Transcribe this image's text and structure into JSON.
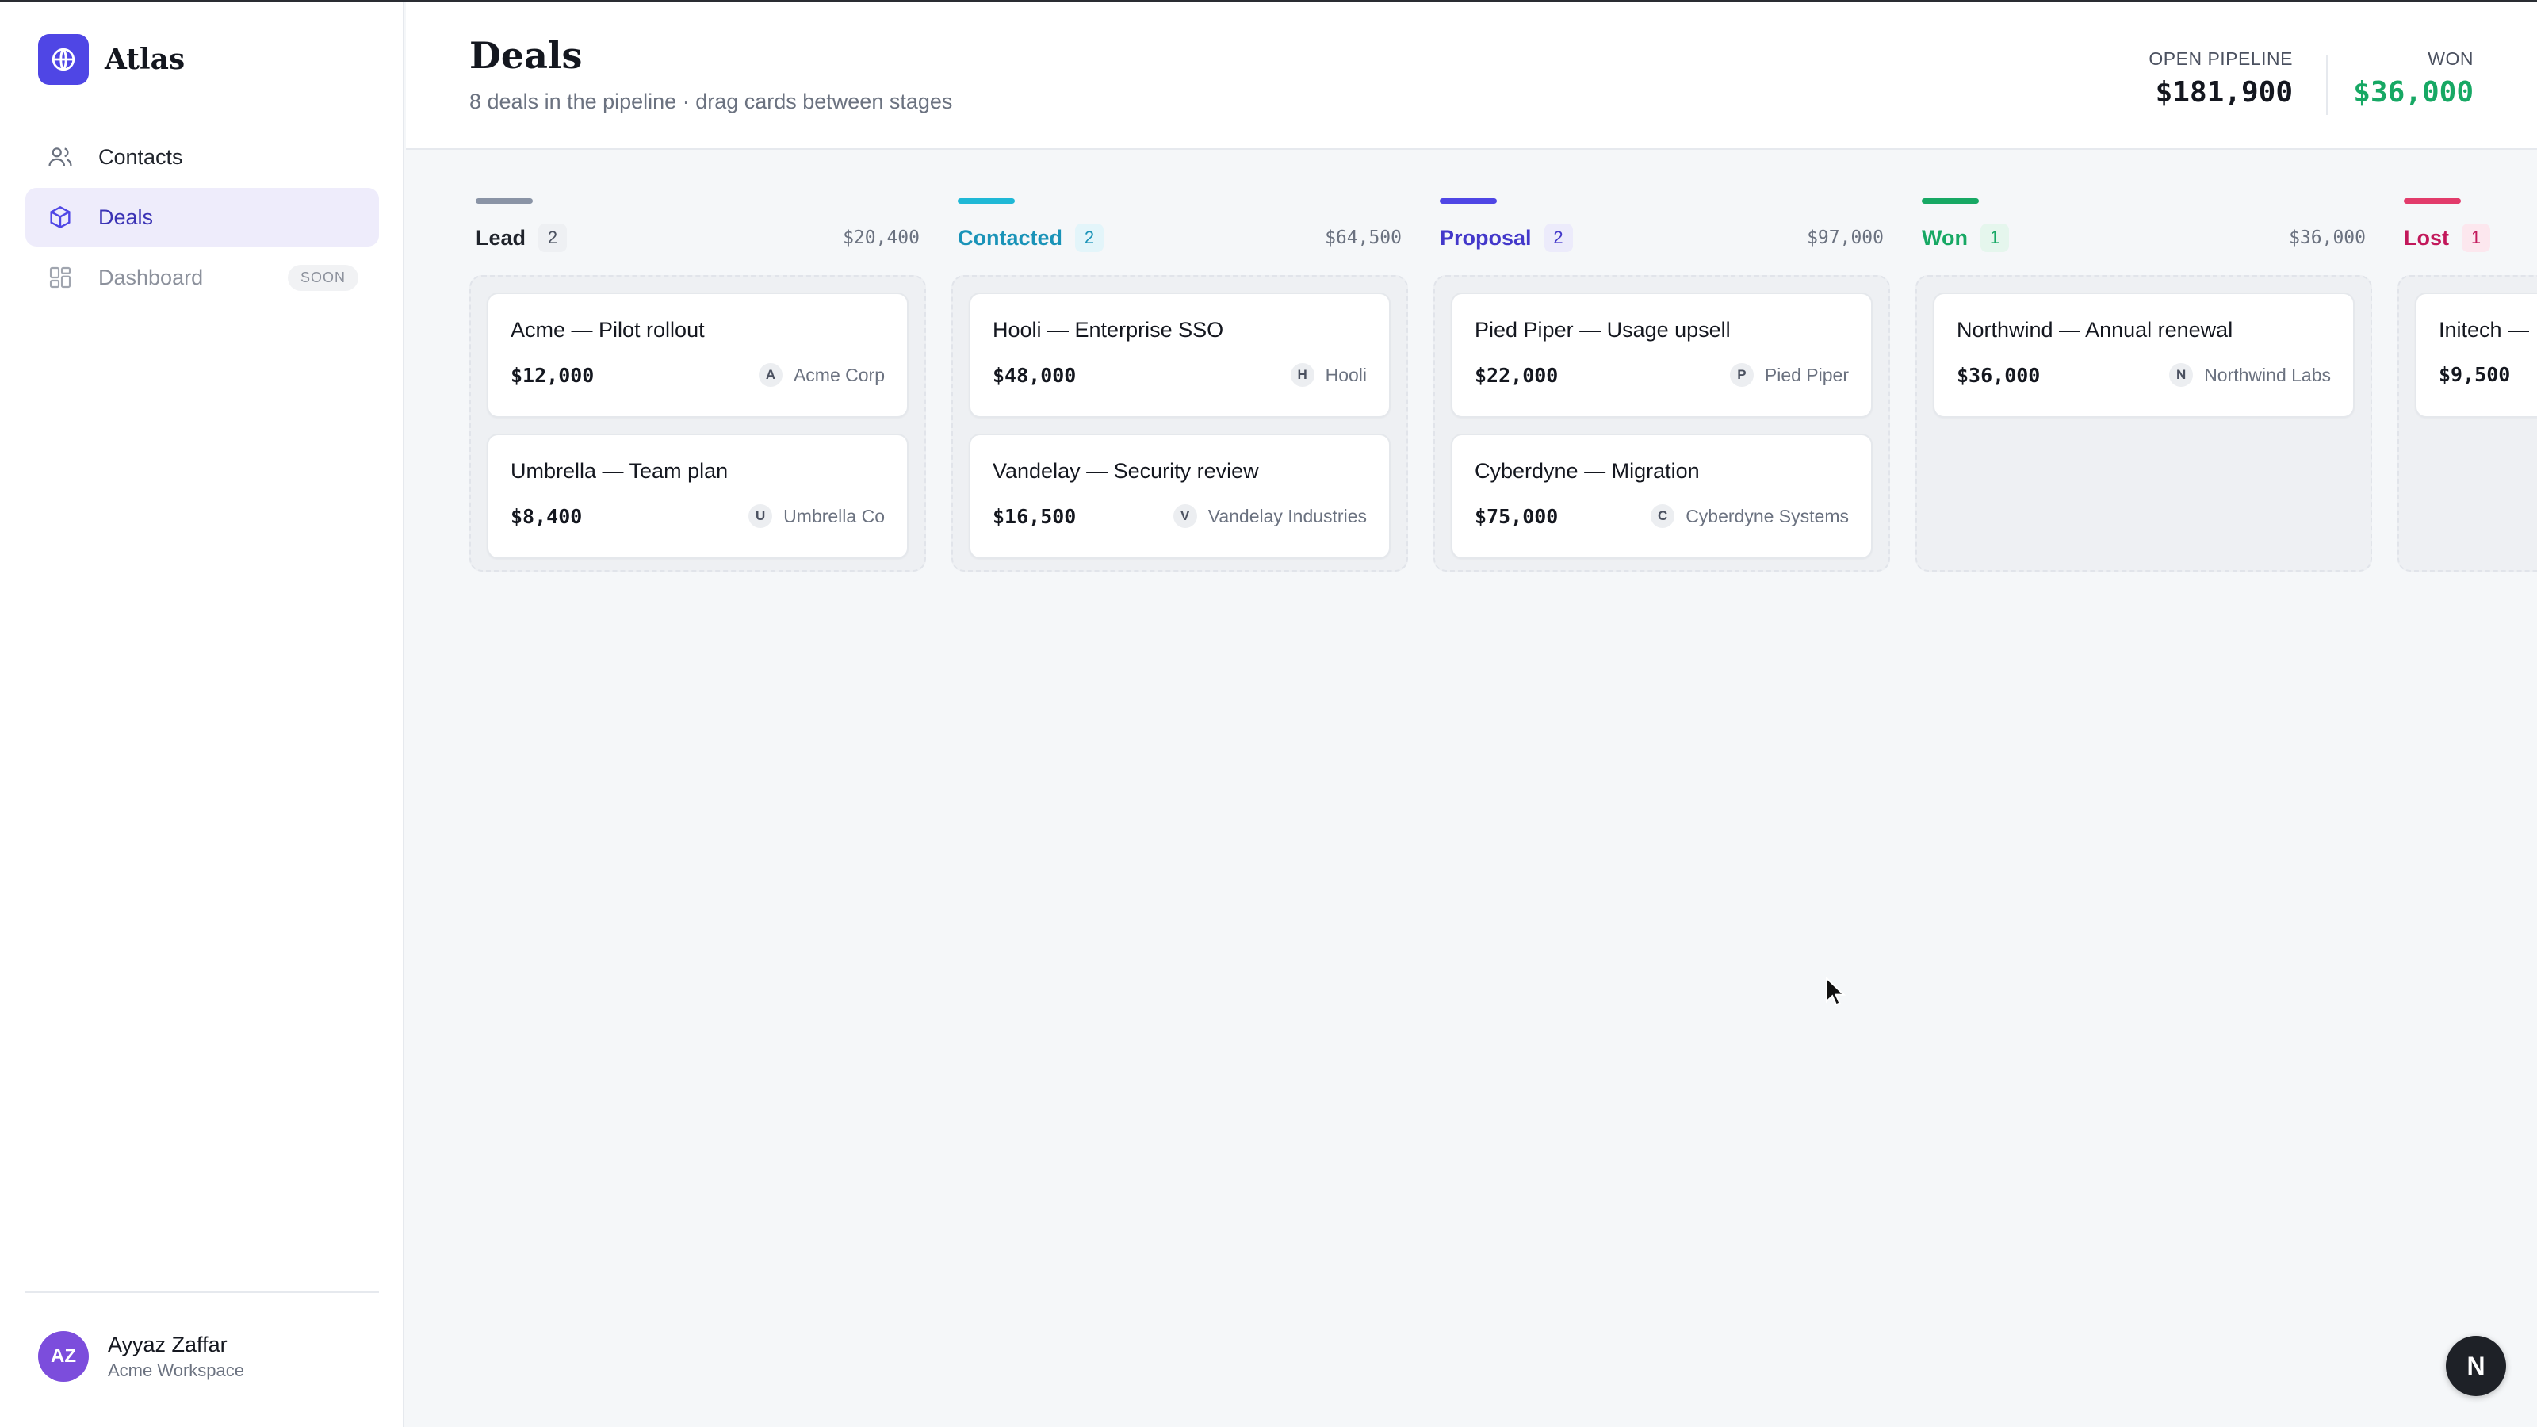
{
  "app": {
    "name": "Atlas"
  },
  "nav": [
    {
      "label": "Contacts",
      "icon": "users-icon",
      "state": "default"
    },
    {
      "label": "Deals",
      "icon": "box-icon",
      "state": "active"
    },
    {
      "label": "Dashboard",
      "icon": "grid-icon",
      "state": "muted",
      "badge": "SOON"
    }
  ],
  "user": {
    "initials": "AZ",
    "name": "Ayyaz Zaffar",
    "workspace": "Acme Workspace"
  },
  "header": {
    "title": "Deals",
    "subtitle": "8 deals in the pipeline · drag cards between stages",
    "stats": {
      "open_pipeline_label": "OPEN PIPELINE",
      "open_pipeline_value": "$181,900",
      "won_label": "WON",
      "won_value": "$36,000"
    }
  },
  "colors": {
    "accent": "#4f46e5",
    "lead": "#8a94a6",
    "contacted": "#1fb8d6",
    "proposal": "#4f46e5",
    "won": "#17a864",
    "lost": "#e23b6b"
  },
  "columns": [
    {
      "name": "Lead",
      "count": "2",
      "total": "$20,400",
      "cards": [
        {
          "title": "Acme — Pilot rollout",
          "amount": "$12,000",
          "initial": "A",
          "company": "Acme Corp"
        },
        {
          "title": "Umbrella — Team plan",
          "amount": "$8,400",
          "initial": "U",
          "company": "Umbrella Co"
        }
      ]
    },
    {
      "name": "Contacted",
      "count": "2",
      "total": "$64,500",
      "cards": [
        {
          "title": "Hooli — Enterprise SSO",
          "amount": "$48,000",
          "initial": "H",
          "company": "Hooli"
        },
        {
          "title": "Vandelay — Security review",
          "amount": "$16,500",
          "initial": "V",
          "company": "Vandelay Industries"
        }
      ]
    },
    {
      "name": "Proposal",
      "count": "2",
      "total": "$97,000",
      "cards": [
        {
          "title": "Pied Piper — Usage upsell",
          "amount": "$22,000",
          "initial": "P",
          "company": "Pied Piper"
        },
        {
          "title": "Cyberdyne — Migration",
          "amount": "$75,000",
          "initial": "C",
          "company": "Cyberdyne Systems"
        }
      ]
    },
    {
      "name": "Won",
      "count": "1",
      "total": "$36,000",
      "cards": [
        {
          "title": "Northwind — Annual renewal",
          "amount": "$36,000",
          "initial": "N",
          "company": "Northwind Labs"
        }
      ]
    },
    {
      "name": "Lost",
      "count": "1",
      "total": "",
      "cards": [
        {
          "title": "Initech —",
          "amount": "$9,500",
          "initial": "",
          "company": ""
        }
      ]
    }
  ],
  "dev_button": {
    "label": "N"
  }
}
